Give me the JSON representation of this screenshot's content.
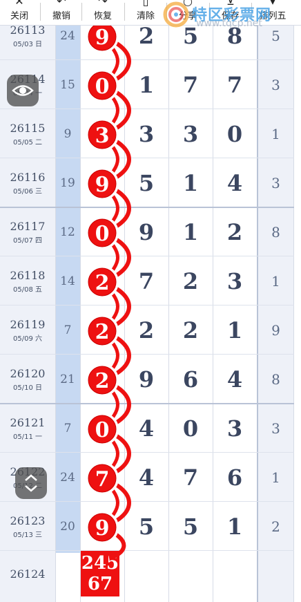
{
  "toolbar": {
    "items": [
      {
        "label": "关闭",
        "icon": "close-icon",
        "glyph": "✕"
      },
      {
        "label": "撤销",
        "icon": "undo-icon",
        "glyph": "↶"
      },
      {
        "label": "恢复",
        "icon": "redo-icon",
        "glyph": "↷"
      },
      {
        "label": "清除",
        "icon": "trash-icon",
        "glyph": "▯"
      },
      {
        "label": "分享",
        "icon": "share-icon",
        "glyph": "○"
      },
      {
        "label": "保存",
        "icon": "save-icon",
        "glyph": "⊻"
      },
      {
        "label": "排列五",
        "icon": "dropdown-icon",
        "glyph": "▾"
      }
    ]
  },
  "logo": {
    "title": "特区彩票网",
    "url": "www.tqcp.net"
  },
  "rows": [
    {
      "issue": "26113",
      "date": "05/03 日",
      "sum": "24",
      "ball": "9",
      "digits": [
        "2",
        "5",
        "8"
      ],
      "last": "5"
    },
    {
      "issue": "26114",
      "date": "05/04 一",
      "sum": "15",
      "ball": "0",
      "digits": [
        "1",
        "7",
        "7"
      ],
      "last": "3"
    },
    {
      "issue": "26115",
      "date": "05/05 二",
      "sum": "9",
      "ball": "3",
      "digits": [
        "3",
        "3",
        "0"
      ],
      "last": "1"
    },
    {
      "issue": "26116",
      "date": "05/06 三",
      "sum": "19",
      "ball": "9",
      "digits": [
        "5",
        "1",
        "4"
      ],
      "last": "3"
    },
    {
      "issue": "26117",
      "date": "05/07 四",
      "sum": "12",
      "ball": "0",
      "digits": [
        "9",
        "1",
        "2"
      ],
      "last": "8"
    },
    {
      "issue": "26118",
      "date": "05/08 五",
      "sum": "14",
      "ball": "2",
      "digits": [
        "7",
        "2",
        "3"
      ],
      "last": "1"
    },
    {
      "issue": "26119",
      "date": "05/09 六",
      "sum": "7",
      "ball": "2",
      "digits": [
        "2",
        "2",
        "1"
      ],
      "last": "9"
    },
    {
      "issue": "26120",
      "date": "05/10 日",
      "sum": "21",
      "ball": "2",
      "digits": [
        "9",
        "6",
        "4"
      ],
      "last": "8"
    },
    {
      "issue": "26121",
      "date": "05/11 一",
      "sum": "7",
      "ball": "0",
      "digits": [
        "4",
        "0",
        "3"
      ],
      "last": "3"
    },
    {
      "issue": "26122",
      "date": "05/12 二",
      "sum": "24",
      "ball": "7",
      "digits": [
        "4",
        "7",
        "6"
      ],
      "last": "1"
    },
    {
      "issue": "26123",
      "date": "05/13 三",
      "sum": "20",
      "ball": "9",
      "digits": [
        "5",
        "5",
        "1"
      ],
      "last": "2"
    }
  ],
  "prediction": {
    "issue": "26124",
    "line1": "245",
    "line2": "67"
  },
  "floating": {
    "eye_icon": "eye-icon",
    "toggle_icon": "expand-collapse-icon"
  },
  "colors": {
    "ball": "#ee1111",
    "trend_line": "#ee1111",
    "sum_column": "#c7d9f2",
    "issue_column": "#eef1f8",
    "logo": "#4aa3e6"
  }
}
